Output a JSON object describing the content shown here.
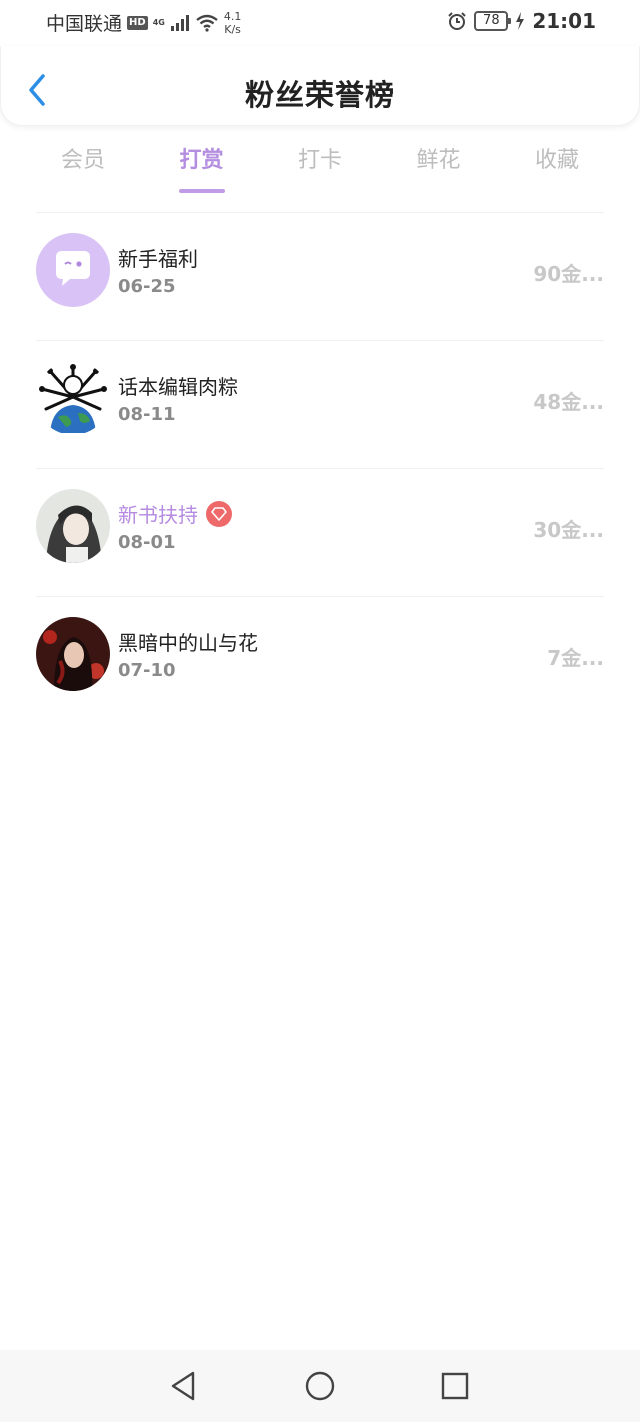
{
  "status_bar": {
    "carrier": "中国联通",
    "hd": "HD",
    "network": "4G",
    "speed_value": "4.1",
    "speed_unit": "K/s",
    "battery": "78",
    "time": "21:01"
  },
  "header": {
    "title": "粉丝荣誉榜"
  },
  "tabs": [
    {
      "label": "会员"
    },
    {
      "label": "打赏"
    },
    {
      "label": "打卡"
    },
    {
      "label": "鲜花"
    },
    {
      "label": "收藏"
    }
  ],
  "active_tab": "打赏",
  "rows": [
    {
      "name": "新手福利",
      "date": "06-25",
      "amount": "90金..."
    },
    {
      "name": "话本编辑肉粽",
      "date": "08-11",
      "amount": "48金..."
    },
    {
      "name": "新书扶持",
      "date": "08-01",
      "amount": "30金..."
    },
    {
      "name": "黑暗中的山与花",
      "date": "07-10",
      "amount": "7金..."
    }
  ],
  "colors": {
    "accent": "#b48ee0",
    "back_arrow": "#2d8ee6",
    "badge": "#ee6a6a"
  }
}
